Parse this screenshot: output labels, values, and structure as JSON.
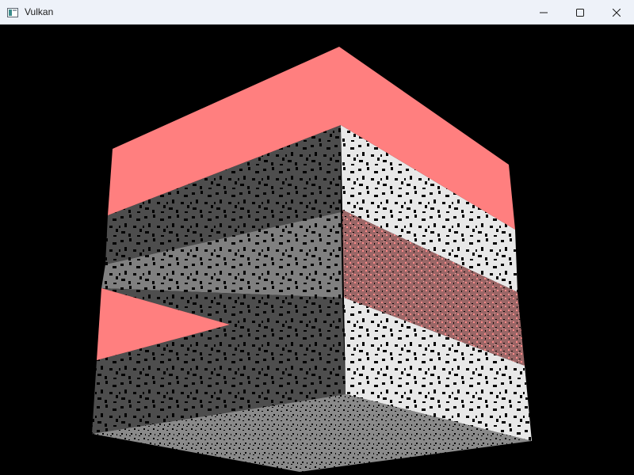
{
  "window": {
    "title": "Vulkan",
    "controls": {
      "minimize_icon": "minimize-icon",
      "maximize_icon": "maximize-icon",
      "close_icon": "close-icon"
    }
  },
  "scene": {
    "background_color": "#000000",
    "colors": {
      "top_face": "#ff7f7f",
      "left_face_band_dark": "#4d4d4d",
      "left_face_band_mid": "#808080",
      "right_face_light": "#e8e8e8",
      "right_face_band_tinted": "#9a6666",
      "bottom_face": "#8a8a8a",
      "noise": "#000000",
      "tint_overlay": "#ff8080"
    }
  }
}
